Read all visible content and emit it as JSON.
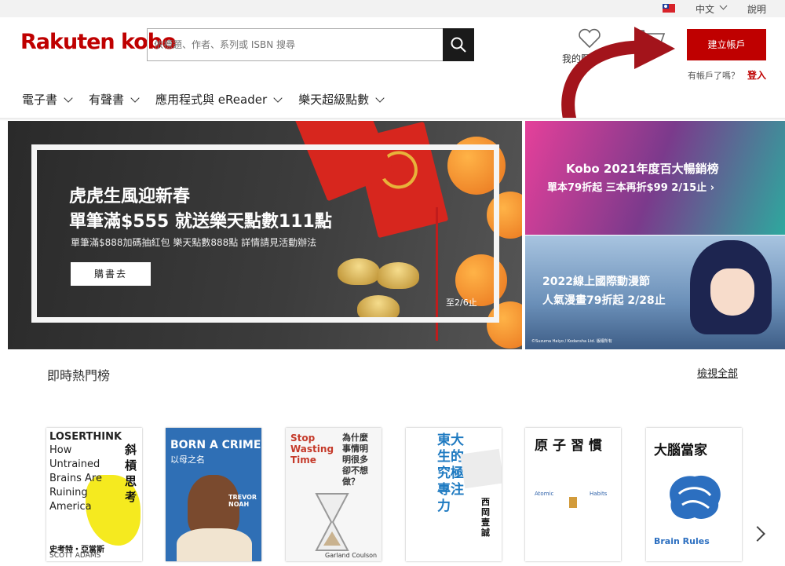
{
  "utility_bar": {
    "language": "中文",
    "help": "說明"
  },
  "header": {
    "logo": "Rakuten kobo",
    "search_placeholder": "依標題、作者、系列或 ISBN 搜尋",
    "wishlist_label": "我的願望",
    "signup_button": "建立帳戶",
    "account_question": "有帳戶了嗎？",
    "login_link": "登入"
  },
  "nav": [
    {
      "label": "電子書"
    },
    {
      "label": "有聲書"
    },
    {
      "label": "應用程式與 eReader"
    },
    {
      "label": "樂天超級點數"
    }
  ],
  "hero": {
    "title_line1": "虎虎生風迎新春",
    "title_line2": "單筆滿$555 就送樂天點數111點",
    "subtitle": "單筆滿$888加碼抽紅包 樂天點數888點 詳情請見活動辦法",
    "button": "購書去",
    "until": "至2/6止"
  },
  "side_banners": [
    {
      "line1": "Kobo 2021年度百大暢銷榜",
      "line2": "單本79折起 三本再折$99 2/15止 ›"
    },
    {
      "line1": "2022線上國際動漫節",
      "line2": "人氣漫畫79折起 2/28止",
      "credit": "©Suzuma Haiyo / Kodansha Ltd. 版權所有"
    }
  ],
  "section": {
    "title": "即時熱門榜",
    "view_all": "檢視全部"
  },
  "books": [
    {
      "title": "LOSERTHINK",
      "subtitle": "How Untrained Brains Are Ruining America",
      "cn_title": "斜槓思考",
      "author": "史考特・亞當斯",
      "author_en": "SCOTT ADAMS"
    },
    {
      "title": "BORN A CRIME",
      "cn_title": "以母之名",
      "author_en": "TREVOR NOAH"
    },
    {
      "title": "Stop Wasting Time",
      "cn_title": "為什麼事情明明很多卻不想做？",
      "author_en": "Garland Coulson"
    },
    {
      "cn_title": "東大生的究極專注力",
      "author": "西岡壹誠"
    },
    {
      "cn_title": "原子習慣",
      "en_words": [
        "Atomic",
        "Habits"
      ]
    },
    {
      "cn_title": "大腦當家",
      "en_title": "Brain Rules"
    }
  ],
  "colors": {
    "brand_red": "#bf0000",
    "search_button": "#1a1a1a"
  }
}
